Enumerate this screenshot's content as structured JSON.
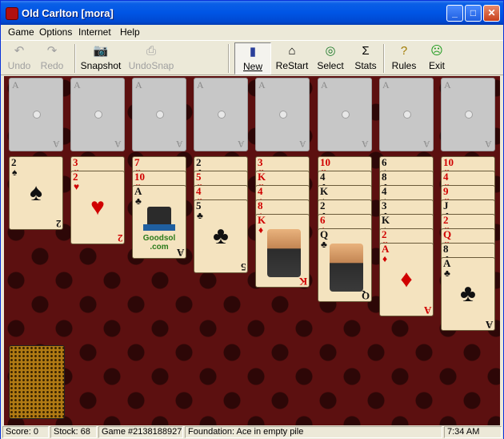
{
  "window": {
    "title": "Old Carlton [mora]"
  },
  "titlebar_buttons": {
    "minimize": "_",
    "maximize": "□",
    "close": "✕"
  },
  "menu": [
    "Game",
    "Options",
    "Internet",
    "Help"
  ],
  "toolbar": {
    "undo": "Undo",
    "redo": "Redo",
    "snapshot": "Snapshot",
    "undosnap": "UndoSnap",
    "new": "New",
    "restart": "ReStart",
    "select": "Select",
    "stats": "Stats",
    "rules": "Rules",
    "exit": "Exit"
  },
  "toolbar_icons": {
    "undo": "↶",
    "redo": "↷",
    "snapshot": "📷",
    "undosnap": "⎙",
    "new": "▮",
    "restart": "⌂",
    "select": "◎",
    "stats": "Σ",
    "rules": "?",
    "exit": "☹"
  },
  "foundations": {
    "ace_label": "A",
    "count": 8
  },
  "tableau": [
    [
      {
        "r": "2",
        "s": "♠",
        "c": "black"
      }
    ],
    [
      {
        "r": "3",
        "s": "♥",
        "c": "red"
      },
      {
        "r": "2",
        "s": "♥",
        "c": "red"
      }
    ],
    [
      {
        "r": "7",
        "s": "♥",
        "c": "red"
      },
      {
        "r": "10",
        "s": "♥",
        "c": "red"
      },
      {
        "r": "A",
        "s": "♣",
        "c": "black",
        "goodsol": true
      }
    ],
    [
      {
        "r": "2",
        "s": "♣",
        "c": "black"
      },
      {
        "r": "5",
        "s": "♥",
        "c": "red"
      },
      {
        "r": "4",
        "s": "♥",
        "c": "red"
      },
      {
        "r": "5",
        "s": "♣",
        "c": "black"
      }
    ],
    [
      {
        "r": "3",
        "s": "♥",
        "c": "red"
      },
      {
        "r": "K",
        "s": "♥",
        "c": "red"
      },
      {
        "r": "4",
        "s": "♦",
        "c": "red"
      },
      {
        "r": "8",
        "s": "♦",
        "c": "red"
      },
      {
        "r": "K",
        "s": "♦",
        "c": "red",
        "face": true
      }
    ],
    [
      {
        "r": "10",
        "s": "♥",
        "c": "red"
      },
      {
        "r": "4",
        "s": "♣",
        "c": "black"
      },
      {
        "r": "K",
        "s": "♠",
        "c": "black"
      },
      {
        "r": "2",
        "s": "♣",
        "c": "black"
      },
      {
        "r": "6",
        "s": "♦",
        "c": "red"
      },
      {
        "r": "Q",
        "s": "♣",
        "c": "black",
        "face": true
      }
    ],
    [
      {
        "r": "6",
        "s": "♠",
        "c": "black"
      },
      {
        "r": "8",
        "s": "♣",
        "c": "black"
      },
      {
        "r": "4",
        "s": "♠",
        "c": "black"
      },
      {
        "r": "3",
        "s": "♣",
        "c": "black"
      },
      {
        "r": "K",
        "s": "♠",
        "c": "black"
      },
      {
        "r": "2",
        "s": "♥",
        "c": "red"
      },
      {
        "r": "A",
        "s": "♦",
        "c": "red"
      }
    ],
    [
      {
        "r": "10",
        "s": "♥",
        "c": "red"
      },
      {
        "r": "4",
        "s": "♥",
        "c": "red"
      },
      {
        "r": "9",
        "s": "♥",
        "c": "red"
      },
      {
        "r": "J",
        "s": "♣",
        "c": "black"
      },
      {
        "r": "2",
        "s": "♥",
        "c": "red"
      },
      {
        "r": "Q",
        "s": "♥",
        "c": "red"
      },
      {
        "r": "8",
        "s": "♣",
        "c": "black"
      },
      {
        "r": "A",
        "s": "♣",
        "c": "black"
      }
    ]
  ],
  "goodsol_text": "Goodsol\n.com",
  "status": {
    "score": "Score:  0",
    "stock": "Stock: 68",
    "game": "Game #2138188927",
    "message": "Foundation: Ace in empty pile",
    "time": "7:34 AM"
  }
}
